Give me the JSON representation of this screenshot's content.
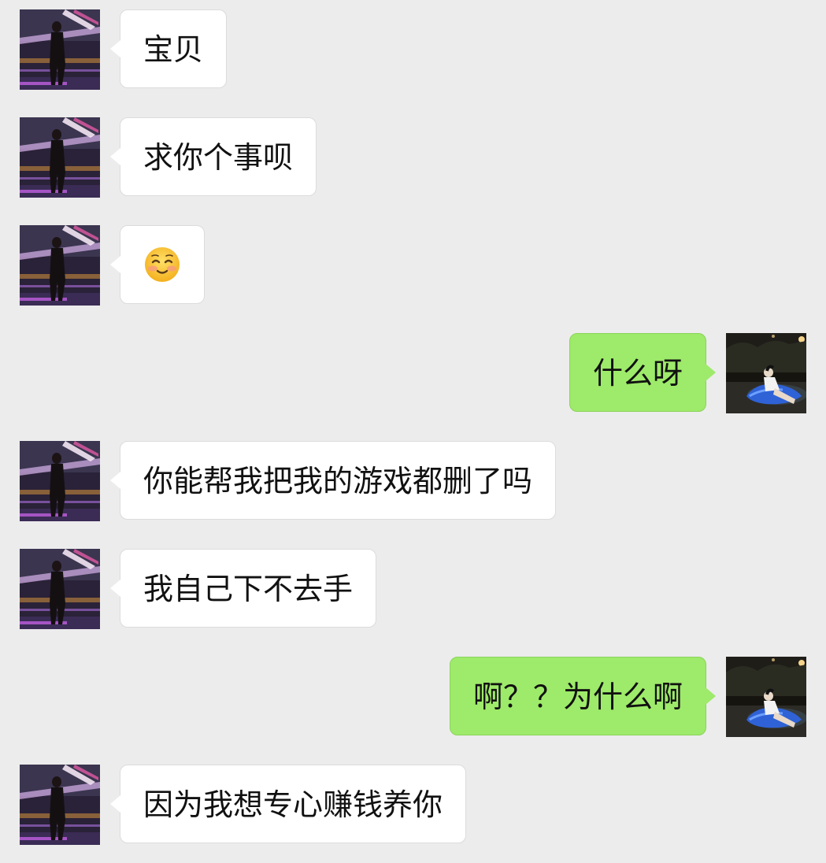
{
  "conversation": {
    "messages": [
      {
        "side": "left",
        "text": "宝贝",
        "avatar": "contact-avatar"
      },
      {
        "side": "left",
        "text": "求你个事呗",
        "avatar": "contact-avatar"
      },
      {
        "side": "left",
        "text": "",
        "emoji": "smiling-face-with-smiling-eyes-icon",
        "avatar": "contact-avatar"
      },
      {
        "side": "right",
        "text": "什么呀",
        "avatar": "self-avatar"
      },
      {
        "side": "left",
        "text": "你能帮我把我的游戏都删了吗",
        "avatar": "contact-avatar"
      },
      {
        "side": "left",
        "text": "我自己下不去手",
        "avatar": "contact-avatar"
      },
      {
        "side": "right",
        "text": "啊？？为什么啊",
        "avatar": "self-avatar"
      },
      {
        "side": "left",
        "text": "因为我想专心赚钱养你",
        "avatar": "contact-avatar"
      }
    ]
  },
  "colors": {
    "background": "#ececec",
    "incoming_bubble": "#ffffff",
    "outgoing_bubble": "#9eea6a",
    "text": "#111111"
  }
}
